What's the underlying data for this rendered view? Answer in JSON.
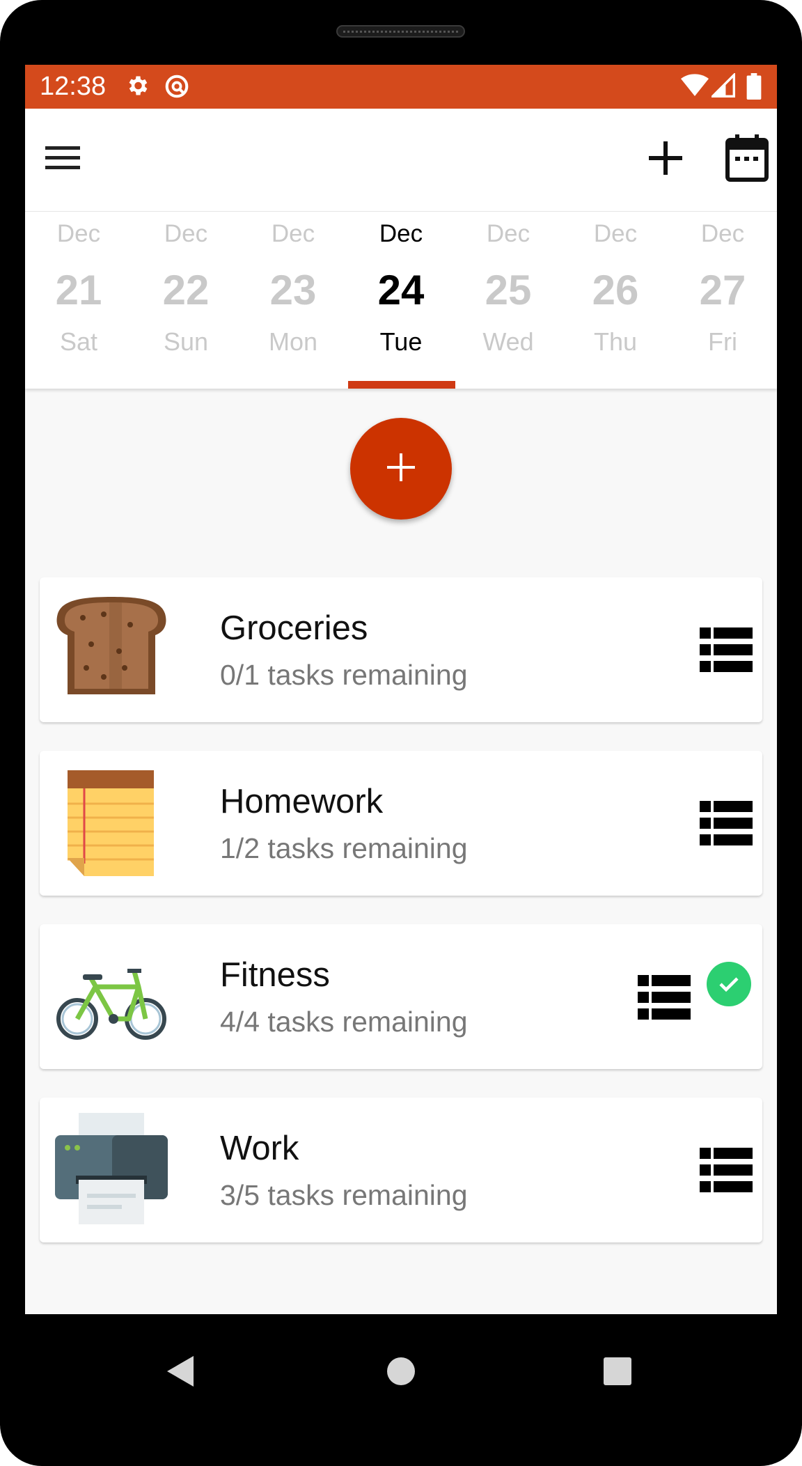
{
  "status_bar": {
    "time": "12:38",
    "icons": [
      "gear-icon",
      "sync-icon",
      "wifi-icon",
      "signal-icon",
      "battery-icon"
    ],
    "background": "#d44a1c"
  },
  "toolbar": {
    "menu_icon": "hamburger-menu-icon",
    "add_icon": "plus-icon",
    "calendar_icon": "calendar-icon"
  },
  "date_strip": {
    "days": [
      {
        "month": "Dec",
        "day": "21",
        "weekday": "Sat"
      },
      {
        "month": "Dec",
        "day": "22",
        "weekday": "Sun"
      },
      {
        "month": "Dec",
        "day": "23",
        "weekday": "Mon"
      },
      {
        "month": "Dec",
        "day": "24",
        "weekday": "Tue"
      },
      {
        "month": "Dec",
        "day": "25",
        "weekday": "Wed"
      },
      {
        "month": "Dec",
        "day": "26",
        "weekday": "Thu"
      },
      {
        "month": "Dec",
        "day": "27",
        "weekday": "Fri"
      }
    ],
    "selected_index": 3,
    "accent": "#cf3a14"
  },
  "fab": {
    "icon": "plus-icon",
    "color": "#cc3300"
  },
  "lists": [
    {
      "title": "Groceries",
      "subtitle": "0/1 tasks remaining",
      "icon": "toast-icon",
      "completed": false
    },
    {
      "title": "Homework",
      "subtitle": "1/2 tasks remaining",
      "icon": "notepad-icon",
      "completed": false
    },
    {
      "title": "Fitness",
      "subtitle": "4/4 tasks remaining",
      "icon": "bicycle-icon",
      "completed": true
    },
    {
      "title": "Work",
      "subtitle": "3/5 tasks remaining",
      "icon": "printer-icon",
      "completed": false
    }
  ],
  "nav_bar": {
    "icons": [
      "back-icon",
      "home-icon",
      "recents-icon"
    ]
  }
}
